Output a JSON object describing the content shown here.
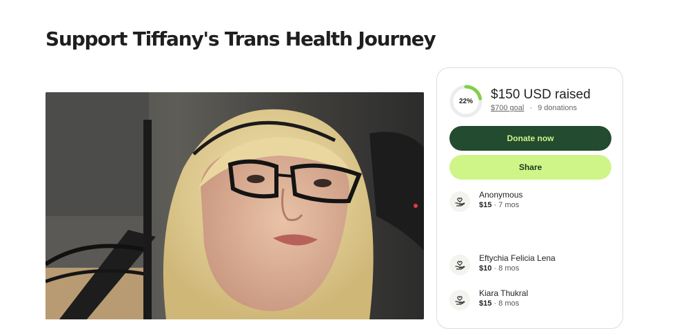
{
  "page": {
    "title": "Support Tiffany's Trans Health Journey"
  },
  "fundraiser": {
    "progress_percent_label": "22%",
    "progress_fraction": 0.22,
    "raised": "$150 USD raised",
    "goal": "$700 goal",
    "separator": "·",
    "donations": "9 donations",
    "donate_label": "Donate now",
    "share_label": "Share"
  },
  "donors": [
    {
      "name": "Anonymous",
      "amount": "$15",
      "time": "· 7 mos"
    },
    {
      "name": "Eftychia Felicia Lena",
      "amount": "$10",
      "time": "· 8 mos"
    },
    {
      "name": "Kiara Thukral",
      "amount": "$15",
      "time": "· 8 mos"
    }
  ],
  "colors": {
    "donate_bg": "#234b2f",
    "donate_text": "#cdf58a",
    "share_bg": "#cff589",
    "progress": "#7fd04a",
    "progress_track": "#ececec"
  },
  "icons": {
    "donor": "heart-in-hand-icon"
  }
}
